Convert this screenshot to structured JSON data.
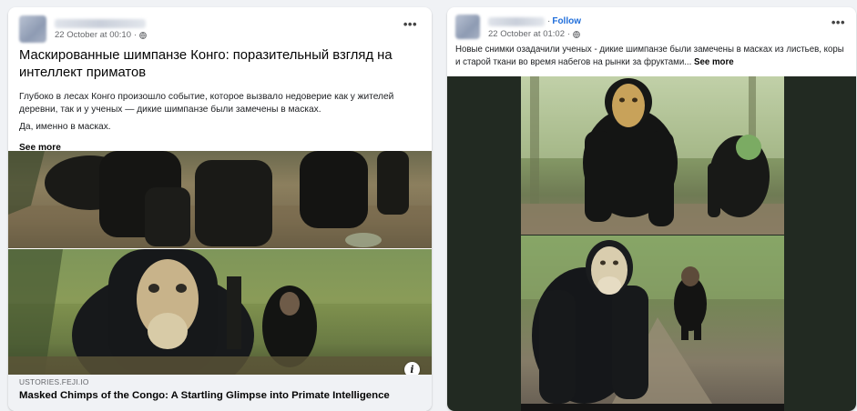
{
  "left_post": {
    "date": "22 October at 00:10",
    "title": "Маскированные шимпанзе Конго: поразительный взгляд на интеллект приматов",
    "body_paragraphs": [
      "Глубоко в лесах Конго произошло событие, которое вызвало недоверие как у жителей деревни, так и у ученых — дикие шимпанзе были замечены в масках.",
      "Да, именно в масках."
    ],
    "see_more": "See more",
    "link_domain": "USTORIES.FEJI.IO",
    "link_title": "Masked Chimps of the Congo: A Startling Glimpse into Primate Intelligence",
    "more_glyph": "•••",
    "info_glyph": "i",
    "dot": "·"
  },
  "right_post": {
    "follow_label": "Follow",
    "date": "22 October at 01:02",
    "body": "Новые снимки озадачили ученых - дикие шимпанзе были замечены в масках из листьев, коры и старой ткани во время набегов на рынки за фруктами...",
    "see_more": "See more",
    "more_glyph": "•••",
    "dot": "·"
  },
  "icons": {
    "globe": "globe-icon",
    "more": "more-options-icon",
    "info": "info-icon"
  },
  "colors": {
    "page_bg": "#f0f2f5",
    "link": "#216fdb",
    "meta": "#65676b"
  }
}
